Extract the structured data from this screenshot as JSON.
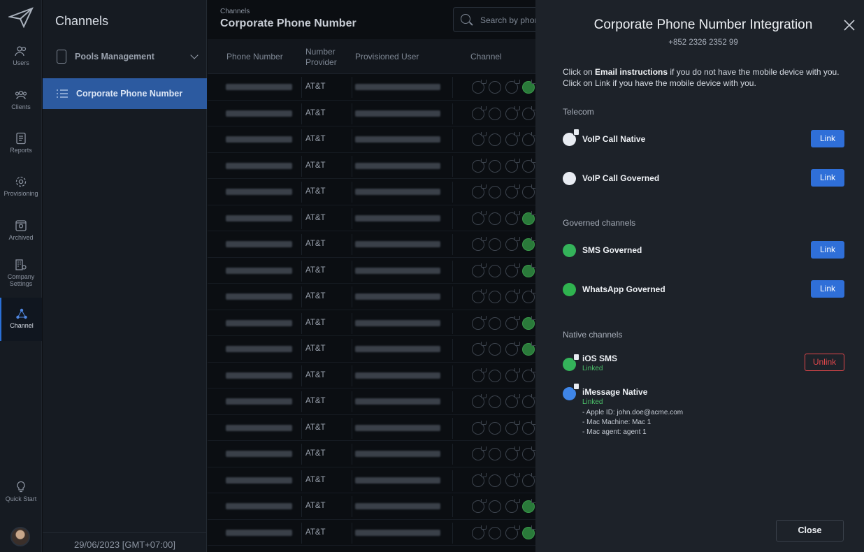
{
  "rail": {
    "items": [
      {
        "label": "Users",
        "icon": "users-icon"
      },
      {
        "label": "Clients",
        "icon": "clients-icon"
      },
      {
        "label": "Reports",
        "icon": "reports-icon"
      },
      {
        "label": "Provisioning",
        "icon": "gear-icon"
      },
      {
        "label": "Archived",
        "icon": "archive-icon"
      },
      {
        "label": "Company",
        "label2": "Settings",
        "icon": "company-settings-icon"
      },
      {
        "label": "Channel",
        "icon": "channel-icon"
      }
    ],
    "quick_start": "Quick Start"
  },
  "channels_panel": {
    "title": "Channels",
    "pools": "Pools Management",
    "corporate": "Corporate Phone Number",
    "footer_date": "29/06/2023 [GMT+07:00]"
  },
  "main": {
    "breadcrumb": "Channels",
    "title": "Corporate Phone Number",
    "search_placeholder": "Search by phone",
    "columns": {
      "phone": "Phone Number",
      "provider_1": "Number",
      "provider_2": "Provider",
      "user": "Provisioned User",
      "channel": "Channel"
    },
    "rows": [
      {
        "provider": "AT&T",
        "green": true
      },
      {
        "provider": "AT&T",
        "green": false
      },
      {
        "provider": "AT&T",
        "green": false
      },
      {
        "provider": "AT&T",
        "green": false
      },
      {
        "provider": "AT&T",
        "green": false
      },
      {
        "provider": "AT&T",
        "green": true
      },
      {
        "provider": "AT&T",
        "green": true
      },
      {
        "provider": "AT&T",
        "green": true
      },
      {
        "provider": "AT&T",
        "green": false
      },
      {
        "provider": "AT&T",
        "green": true
      },
      {
        "provider": "AT&T",
        "green": true
      },
      {
        "provider": "AT&T",
        "green": false
      },
      {
        "provider": "AT&T",
        "green": false
      },
      {
        "provider": "AT&T",
        "green": false
      },
      {
        "provider": "AT&T",
        "green": false
      },
      {
        "provider": "AT&T",
        "green": false
      },
      {
        "provider": "AT&T",
        "green": true
      },
      {
        "provider": "AT&T",
        "green": true
      }
    ]
  },
  "drawer": {
    "title": "Corporate Phone Number Integration",
    "phone": "+852 2326 2352 99",
    "instr1_pre": "Click on ",
    "instr1_bold": "Email instructions",
    "instr1_post": " if you do not have the mobile device with you.",
    "instr2": "Click on Link if you have the mobile device with you.",
    "telecom": "Telecom",
    "voip_native": "VoIP Call Native",
    "voip_governed": "VoIP Call Governed",
    "governed_channels": "Governed channels",
    "sms_governed": "SMS Governed",
    "whatsapp_governed": "WhatsApp Governed",
    "native_channels": "Native channels",
    "ios_sms": "iOS SMS",
    "imessage": "iMessage Native",
    "linked": "Linked",
    "link_label": "Link",
    "unlink_label": "Unlink",
    "detail_apple": "- Apple ID: john.doe@acme.com",
    "detail_mac": "- Mac Machine: Mac 1",
    "detail_agent": "- Mac agent: agent 1",
    "close_label": "Close",
    "colors": {
      "link": "#2f6fd8",
      "unlink": "#e0474b",
      "linked": "#4cc26a"
    }
  }
}
